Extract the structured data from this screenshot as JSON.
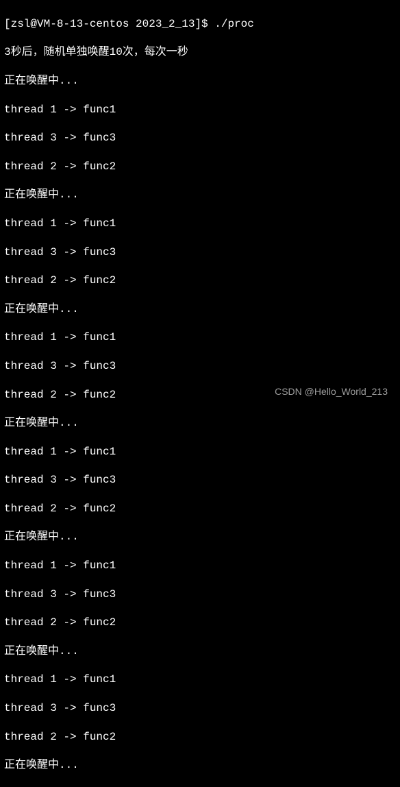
{
  "prompt": {
    "user_host": "[zsl@VM-8-13-centos 2023_2_13]$ ",
    "command": "./proc"
  },
  "intro": "3秒后，随机单独唤醒10次，每次一秒",
  "wakeup_label": "正在唤醒中...",
  "thread_lines": {
    "t1": "thread 1 -> func1",
    "t3": "thread 3 -> func3",
    "t2": "thread 2 -> func2"
  },
  "blocks": [
    {
      "wakeup": true,
      "threads": [
        "t1",
        "t3",
        "t2"
      ]
    },
    {
      "wakeup": true,
      "threads": [
        "t1",
        "t3",
        "t2"
      ]
    },
    {
      "wakeup": true,
      "threads": [
        "t1",
        "t3",
        "t2"
      ]
    },
    {
      "wakeup": true,
      "threads": [
        "t1",
        "t3",
        "t2"
      ]
    },
    {
      "wakeup": true,
      "threads": [
        "t1",
        "t3",
        "t2"
      ]
    },
    {
      "wakeup": true,
      "threads": [
        "t1",
        "t3",
        "t2"
      ]
    },
    {
      "wakeup": true,
      "threads": []
    }
  ],
  "watermark": "CSDN @Hello_World_213"
}
